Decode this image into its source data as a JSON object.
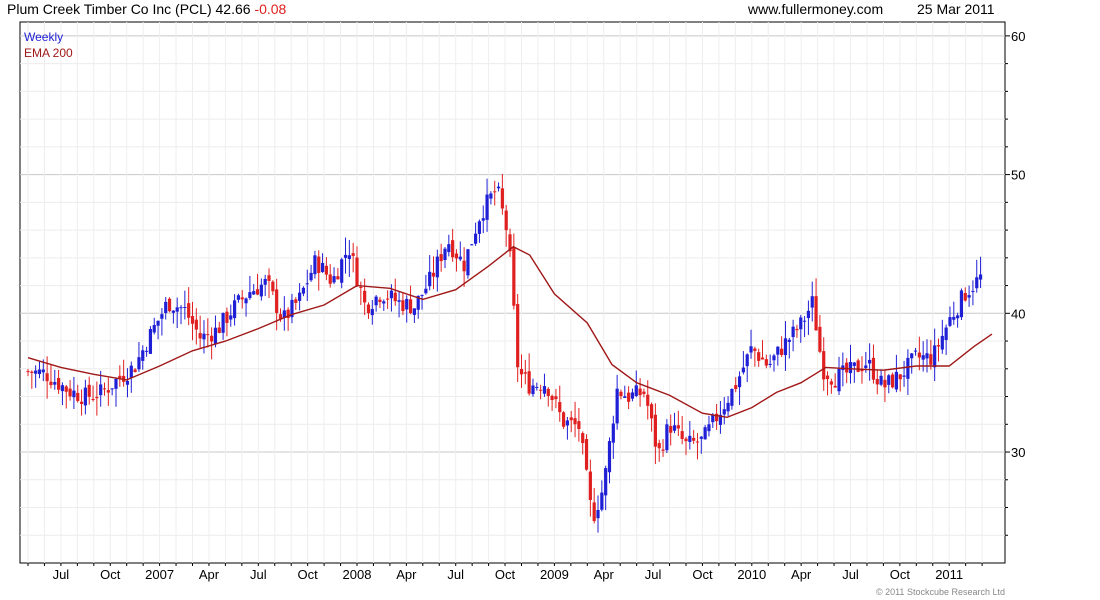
{
  "header": {
    "symbol_title": "Plum Creek Timber Co Inc (PCL)",
    "last_price": "42.66",
    "change": "-0.08",
    "website": "www.fullermoney.com",
    "date": "25 Mar 2011"
  },
  "copyright": "© 2011 Stockcube Research Ltd",
  "colors": {
    "up_candle": "#1f1fd6",
    "down_candle": "#e02020",
    "ema_line": "#a01818",
    "grid": "#d9d9d9",
    "axis": "#000000",
    "change_text": "#e02020"
  },
  "chart_data": {
    "type": "candlestick",
    "legend": [
      {
        "label": "Weekly",
        "color": "#1f1fd6"
      },
      {
        "label": "EMA 200",
        "color": "#a01818"
      }
    ],
    "legend_position": "top-left",
    "ylim": [
      22,
      61
    ],
    "yticks": [
      30,
      40,
      50,
      60
    ],
    "y_axis_side": "right",
    "grid": true,
    "xlim_months": [
      0,
      58.6
    ],
    "xtick_labels": [
      {
        "label": "Jul",
        "m": 2
      },
      {
        "label": "Oct",
        "m": 5
      },
      {
        "label": "2007",
        "m": 8
      },
      {
        "label": "Apr",
        "m": 11
      },
      {
        "label": "Jul",
        "m": 14
      },
      {
        "label": "Oct",
        "m": 17
      },
      {
        "label": "2008",
        "m": 20
      },
      {
        "label": "Apr",
        "m": 23
      },
      {
        "label": "Jul",
        "m": 26
      },
      {
        "label": "Oct",
        "m": 29
      },
      {
        "label": "2009",
        "m": 32
      },
      {
        "label": "Apr",
        "m": 35
      },
      {
        "label": "Jul",
        "m": 38
      },
      {
        "label": "Oct",
        "m": 41
      },
      {
        "label": "2010",
        "m": 44
      },
      {
        "label": "Apr",
        "m": 47
      },
      {
        "label": "Jul",
        "m": 50
      },
      {
        "label": "Oct",
        "m": 53
      },
      {
        "label": "2011",
        "m": 56
      }
    ],
    "price_path": [
      [
        0.0,
        35.8
      ],
      [
        1.0,
        35.7
      ],
      [
        2.5,
        34.4
      ],
      [
        3.5,
        34.0
      ],
      [
        4.5,
        34.3
      ],
      [
        5.5,
        35.3
      ],
      [
        6.5,
        36.2
      ],
      [
        7.5,
        38.6
      ],
      [
        8.5,
        40.8
      ],
      [
        9.5,
        40.3
      ],
      [
        10.5,
        38.2
      ],
      [
        11.5,
        38.8
      ],
      [
        12.5,
        40.4
      ],
      [
        13.5,
        41.6
      ],
      [
        14.5,
        42.2
      ],
      [
        15.5,
        39.5
      ],
      [
        16.5,
        41.0
      ],
      [
        17.5,
        43.8
      ],
      [
        18.5,
        42.3
      ],
      [
        19.5,
        44.8
      ],
      [
        20.5,
        40.5
      ],
      [
        21.5,
        41.5
      ],
      [
        22.5,
        40.8
      ],
      [
        23.5,
        40.5
      ],
      [
        24.5,
        42.5
      ],
      [
        25.5,
        45.3
      ],
      [
        26.5,
        43.5
      ],
      [
        27.5,
        47.2
      ],
      [
        28.5,
        49.0
      ],
      [
        29.2,
        45.5
      ],
      [
        29.8,
        35.8
      ],
      [
        30.5,
        34.8
      ],
      [
        31.5,
        35.0
      ],
      [
        32.5,
        32.2
      ],
      [
        33.5,
        31.8
      ],
      [
        34.3,
        25.2
      ],
      [
        35.0,
        27.5
      ],
      [
        35.8,
        34.5
      ],
      [
        36.5,
        34.0
      ],
      [
        37.5,
        34.3
      ],
      [
        38.3,
        29.8
      ],
      [
        39.0,
        32.0
      ],
      [
        40.0,
        30.5
      ],
      [
        41.0,
        30.8
      ],
      [
        42.0,
        32.8
      ],
      [
        43.0,
        34.8
      ],
      [
        44.0,
        37.5
      ],
      [
        45.0,
        36.2
      ],
      [
        46.0,
        37.8
      ],
      [
        47.0,
        39.2
      ],
      [
        47.7,
        40.8
      ],
      [
        48.3,
        36.0
      ],
      [
        49.0,
        35.3
      ],
      [
        50.0,
        35.8
      ],
      [
        51.0,
        36.5
      ],
      [
        52.0,
        34.7
      ],
      [
        53.0,
        35.5
      ],
      [
        54.0,
        36.8
      ],
      [
        55.0,
        36.8
      ],
      [
        56.0,
        39.5
      ],
      [
        57.0,
        41.5
      ],
      [
        58.0,
        42.7
      ]
    ],
    "weeks_per_month": 4.3,
    "ema_path": [
      [
        0.0,
        36.8
      ],
      [
        2.0,
        36.1
      ],
      [
        4.0,
        35.6
      ],
      [
        6.0,
        35.2
      ],
      [
        8.0,
        36.2
      ],
      [
        10.0,
        37.3
      ],
      [
        12.0,
        38.0
      ],
      [
        14.0,
        38.9
      ],
      [
        16.0,
        39.9
      ],
      [
        18.0,
        40.6
      ],
      [
        20.0,
        42.0
      ],
      [
        22.0,
        41.8
      ],
      [
        24.0,
        41.0
      ],
      [
        26.0,
        41.7
      ],
      [
        28.0,
        43.4
      ],
      [
        29.5,
        44.8
      ],
      [
        30.5,
        44.2
      ],
      [
        32.0,
        41.4
      ],
      [
        34.0,
        39.3
      ],
      [
        35.5,
        36.3
      ],
      [
        37.0,
        35.0
      ],
      [
        39.0,
        34.1
      ],
      [
        41.0,
        32.8
      ],
      [
        42.5,
        32.5
      ],
      [
        44.0,
        33.2
      ],
      [
        45.5,
        34.3
      ],
      [
        47.0,
        35.0
      ],
      [
        48.5,
        36.1
      ],
      [
        50.0,
        36.0
      ],
      [
        52.0,
        35.9
      ],
      [
        54.0,
        36.2
      ],
      [
        56.0,
        36.2
      ],
      [
        57.5,
        37.6
      ],
      [
        58.6,
        38.5
      ]
    ]
  }
}
